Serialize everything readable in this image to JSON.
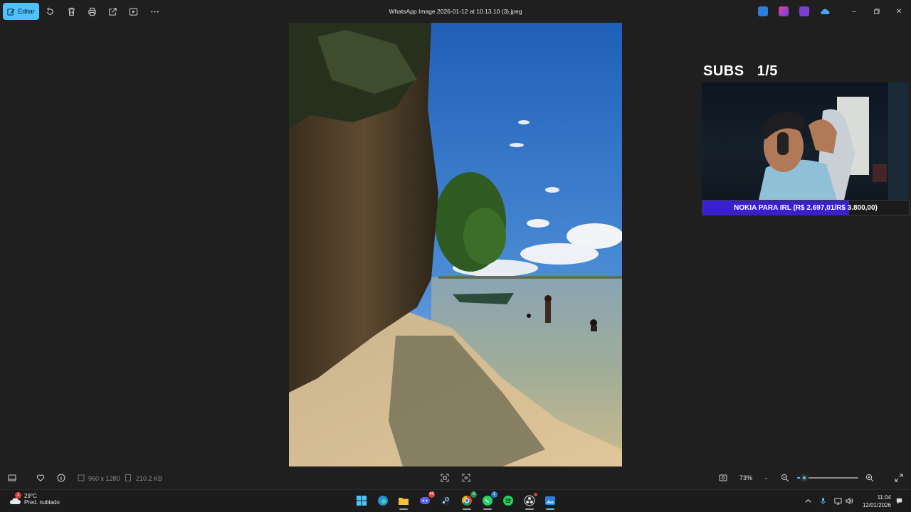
{
  "toolbar": {
    "edit_label": "Editar",
    "title": "WhatsApp Image 2026-01-12 at 10.13.10 (3).jpeg",
    "icons": [
      "rotate-icon",
      "delete-icon",
      "print-icon",
      "share-icon",
      "slideshow-icon",
      "more-icon"
    ],
    "window_controls": [
      "minimize",
      "maximize",
      "close"
    ]
  },
  "overlay": {
    "subs_label": "SUBS",
    "subs_count": "1/5",
    "goal_text": "NOKIA PARA IRL (R$ 2.697,01/R$ 3.800,00)",
    "goal_progress": 0.7097
  },
  "infobar": {
    "dimensions": "960 x 1280",
    "file_size": "210.2 KB",
    "zoom": "73%",
    "zoom_level": 0.12
  },
  "taskbar": {
    "weather_badge": "1",
    "temperature": "29°C",
    "condition": "Pred. nublado",
    "apps": [
      {
        "name": "start",
        "badge": ""
      },
      {
        "name": "edge",
        "badge": ""
      },
      {
        "name": "file-explorer",
        "badge": ""
      },
      {
        "name": "discord",
        "badge": "40"
      },
      {
        "name": "steam",
        "badge": ""
      },
      {
        "name": "chrome",
        "badge": "6"
      },
      {
        "name": "whatsapp",
        "badge": "1"
      },
      {
        "name": "spotify",
        "badge": ""
      },
      {
        "name": "obs",
        "badge": ""
      },
      {
        "name": "photos",
        "badge": ""
      }
    ],
    "time": "11:04",
    "date": "12/01/2026"
  }
}
